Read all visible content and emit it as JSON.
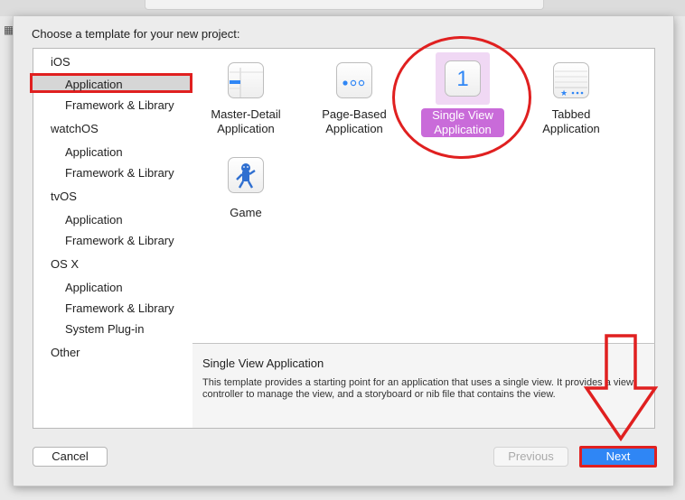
{
  "dialog": {
    "prompt": "Choose a template for your new project:"
  },
  "sidebar": {
    "groups": [
      {
        "label": "iOS",
        "items": [
          "Application",
          "Framework & Library"
        ]
      },
      {
        "label": "watchOS",
        "items": [
          "Application",
          "Framework & Library"
        ]
      },
      {
        "label": "tvOS",
        "items": [
          "Application",
          "Framework & Library"
        ]
      },
      {
        "label": "OS X",
        "items": [
          "Application",
          "Framework & Library",
          "System Plug-in"
        ]
      },
      {
        "label": "Other",
        "items": []
      }
    ],
    "selected": "iOS / Application"
  },
  "templates": [
    {
      "label_line1": "Master-Detail",
      "label_line2": "Application",
      "icon": "master-detail-icon"
    },
    {
      "label_line1": "Page-Based",
      "label_line2": "Application",
      "icon": "page-based-icon"
    },
    {
      "label_line1": "Single View",
      "label_line2": "Application",
      "icon": "single-view-icon",
      "icon_text": "1",
      "selected": true
    },
    {
      "label_line1": "Tabbed",
      "label_line2": "Application",
      "icon": "tabbed-icon"
    },
    {
      "label_line1": "Game",
      "label_line2": "",
      "icon": "game-icon"
    }
  ],
  "description": {
    "title": "Single View Application",
    "body": "This template provides a starting point for an application that uses a single view. It provides a view controller to manage the view, and a storyboard or nib file that contains the view."
  },
  "buttons": {
    "cancel": "Cancel",
    "previous": "Previous",
    "next": "Next"
  },
  "colors": {
    "annotation_red": "#e02020",
    "selection_purple": "#c96bd9",
    "next_blue": "#2f86f5"
  }
}
